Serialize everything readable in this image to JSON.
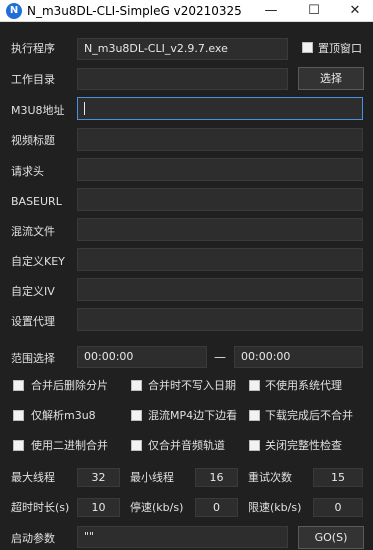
{
  "window": {
    "title": "N_m3u8DL-CLI-SimpleG v20210325",
    "icon_letter": "N",
    "minimize": "—",
    "maximize": "☐",
    "close": "✕"
  },
  "form": {
    "exe_label": "执行程序",
    "exe_value": "N_m3u8DL-CLI_v2.9.7.exe",
    "topmost_label": "置顶窗口",
    "topmost_checked": false,
    "workdir_label": "工作目录",
    "workdir_value": "",
    "browse_button": "选择",
    "m3u8_label": "M3U8地址",
    "m3u8_value": "",
    "title_label": "视频标题",
    "title_value": "",
    "headers_label": "请求头",
    "headers_value": "",
    "baseurl_label": "BASEURL",
    "baseurl_value": "",
    "mux_label": "混流文件",
    "mux_value": "",
    "key_label": "自定义KEY",
    "key_value": "",
    "iv_label": "自定义IV",
    "iv_value": "",
    "proxy_label": "设置代理",
    "proxy_value": "",
    "range_label": "范围选择",
    "range_start": "00:00:00",
    "range_sep": "—",
    "range_end": "00:00:00"
  },
  "options": [
    {
      "label": "合并后删除分片",
      "checked": false
    },
    {
      "label": "合并时不写入日期",
      "checked": false
    },
    {
      "label": "不使用系统代理",
      "checked": false
    },
    {
      "label": "仅解析m3u8",
      "checked": false
    },
    {
      "label": "混流MP4边下边看",
      "checked": false
    },
    {
      "label": "下载完成后不合并",
      "checked": false
    },
    {
      "label": "使用二进制合并",
      "checked": false
    },
    {
      "label": "仅合并音频轨道",
      "checked": false
    },
    {
      "label": "关闭完整性检查",
      "checked": false
    }
  ],
  "numbers": {
    "max_threads_label": "最大线程",
    "max_threads": "32",
    "min_threads_label": "最小线程",
    "min_threads": "16",
    "retries_label": "重试次数",
    "retries": "15",
    "timeout_label": "超时时长(s)",
    "timeout": "10",
    "stop_speed_label": "停速(kb/s)",
    "stop_speed": "0",
    "limit_speed_label": "限速(kb/s)",
    "limit_speed": "0"
  },
  "footer": {
    "args_label": "启动参数",
    "args_value": "\"\"",
    "go_button": "GO(S)"
  },
  "colors": {
    "background": "#202020",
    "field": "#2d2d2d",
    "focus_border": "#4b8fe0",
    "app_icon": "#1f6fd6"
  }
}
